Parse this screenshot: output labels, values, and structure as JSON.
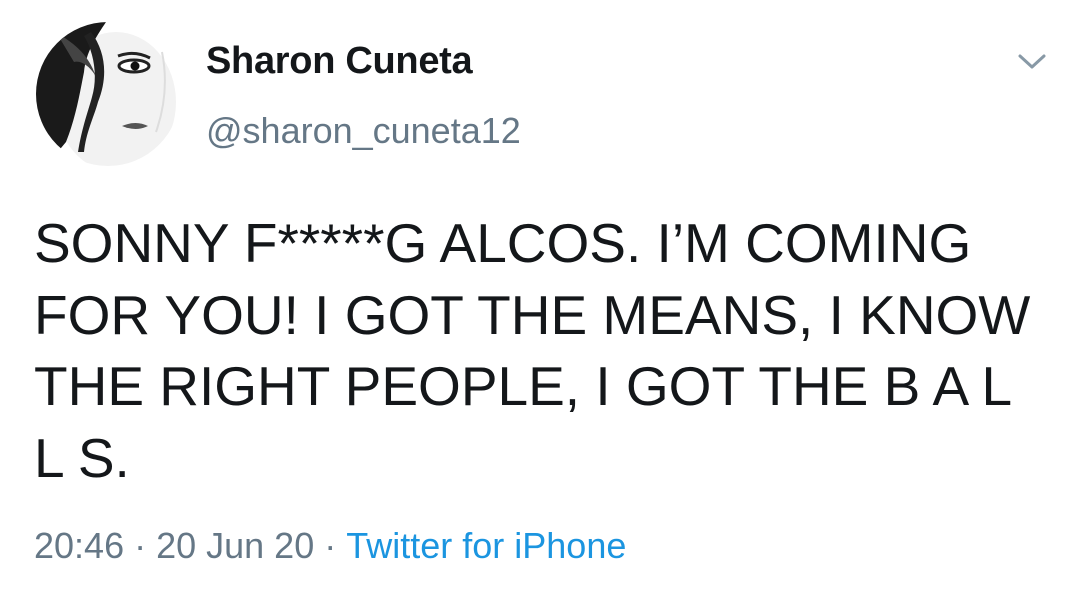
{
  "tweet": {
    "author": {
      "name": "Sharon Cuneta",
      "handle": "@sharon_cuneta12"
    },
    "text": "SONNY F*****G ALCOS. I’M COMING FOR YOU! I GOT THE MEANS, I KNOW THE RIGHT PEOPLE, I GOT THE B A L L S.",
    "time": "20:46",
    "date": "20 Jun 20",
    "separator": "·",
    "source": "Twitter for iPhone",
    "menu_icon": "chevron-down-icon",
    "colors": {
      "text": "#14171a",
      "secondary": "#657786",
      "link": "#1b95e0"
    }
  }
}
